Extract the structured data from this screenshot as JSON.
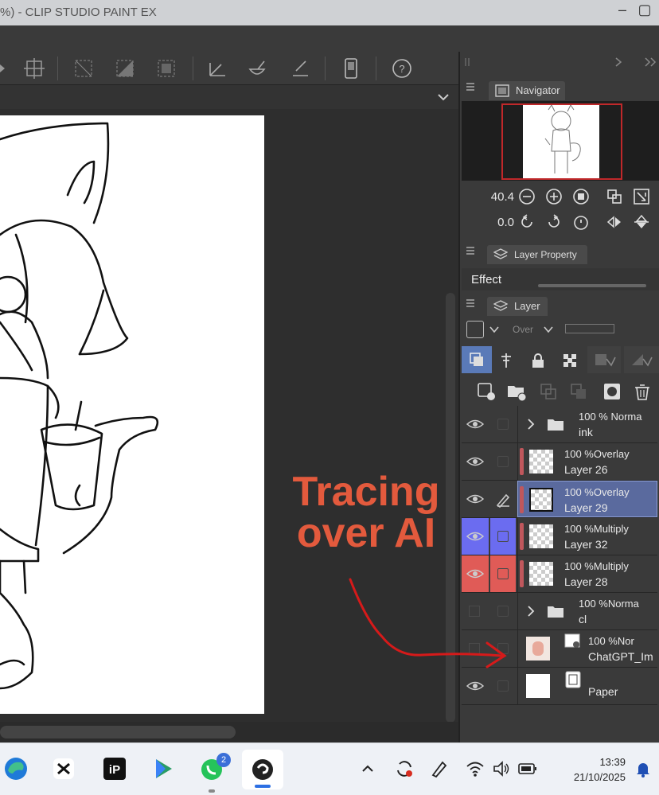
{
  "window": {
    "title": "%)  - CLIP STUDIO PAINT EX"
  },
  "navigator": {
    "tab_label": "Navigator",
    "zoom": "40.4",
    "rotation": "0.0"
  },
  "layer_property": {
    "tab_label": "Layer Property",
    "effect_label": "Effect"
  },
  "layer_panel": {
    "tab_label": "Layer",
    "blend_mode_select": "Over",
    "layers": [
      {
        "line1": "100 % Norma",
        "line2": "ink",
        "kind": "folder",
        "color": "",
        "eye": true
      },
      {
        "line1": "100 %Overlay",
        "line2": "Layer 26",
        "kind": "raster",
        "color": "#c0575c",
        "eye": true
      },
      {
        "line1": "100 %Overlay",
        "line2": "Layer 29",
        "kind": "raster",
        "color": "#c0575c",
        "eye": true,
        "selected": true
      },
      {
        "line1": "100 %Multiply",
        "line2": "Layer 32",
        "kind": "raster",
        "color": "#c0575c",
        "eye": true,
        "cell_color": "#6b6cf0"
      },
      {
        "line1": "100 %Multiply",
        "line2": "Layer 28",
        "kind": "raster",
        "color": "#c0575c",
        "eye": true,
        "cell_color": "#e05b57"
      },
      {
        "line1": "100 %Norma",
        "line2": "cl",
        "kind": "folder",
        "color": "",
        "eye": false
      },
      {
        "line1": "100 %Nor",
        "line2": "ChatGPT_Im",
        "kind": "image",
        "color": "",
        "eye": false
      },
      {
        "line1": "",
        "line2": "Paper",
        "kind": "paper",
        "color": "",
        "eye": true
      }
    ]
  },
  "annotation": {
    "line1": "Tracing",
    "line2": "over AI",
    "color": "#e35a3d"
  },
  "taskbar": {
    "time": "13:39",
    "date": "21/10/2025",
    "whatsapp_badge": "2"
  }
}
